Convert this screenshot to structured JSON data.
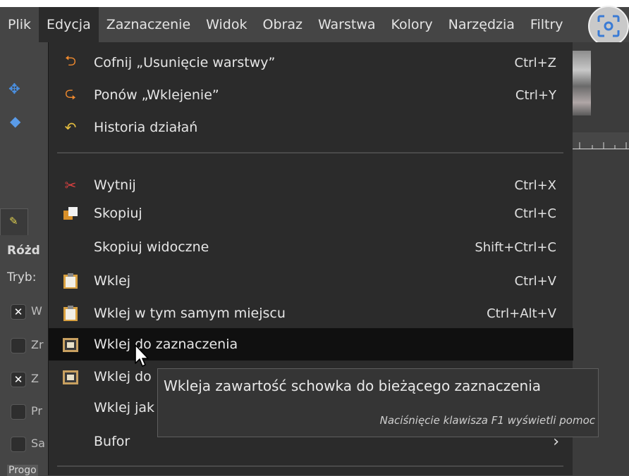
{
  "menubar": {
    "items": [
      "Plik",
      "Edycja",
      "Zaznaczenie",
      "Widok",
      "Obraz",
      "Warstwa",
      "Kolory",
      "Narzędzia",
      "Filtry"
    ],
    "active_index": 1
  },
  "background": {
    "panel_title": "Różd",
    "mode_label": "Tryb:",
    "options": [
      {
        "checked": true,
        "text": "W"
      },
      {
        "checked": false,
        "text": "Zr"
      },
      {
        "checked": true,
        "text": "Z"
      },
      {
        "checked": false,
        "text": "Pr"
      },
      {
        "checked": false,
        "text": "Sa"
      }
    ],
    "bottom_label": "Progo"
  },
  "menu": {
    "items": [
      {
        "label": "Cofnij „Usunięcie warstwy”",
        "shortcut": "Ctrl+Z",
        "icon": "undo-icon"
      },
      {
        "label": "Ponów „Wklejenie”",
        "shortcut": "Ctrl+Y",
        "icon": "redo-icon"
      },
      {
        "label": "Historia działań",
        "shortcut": "",
        "icon": "history-icon"
      },
      {
        "label": "Wytnij",
        "shortcut": "Ctrl+X",
        "icon": "cut-icon"
      },
      {
        "label": "Skopiuj",
        "shortcut": "Ctrl+C",
        "icon": "copy-icon"
      },
      {
        "label": "Skopiuj widoczne",
        "shortcut": "Shift+Ctrl+C",
        "icon": ""
      },
      {
        "label": "Wklej",
        "shortcut": "Ctrl+V",
        "icon": "paste-icon"
      },
      {
        "label": "Wklej w tym samym miejscu",
        "shortcut": "Ctrl+Alt+V",
        "icon": "paste-in-place-icon"
      },
      {
        "label": "Wklej do zaznaczenia",
        "shortcut": "",
        "icon": "paste-into-selection-icon"
      },
      {
        "label": "Wklej do",
        "shortcut": "",
        "icon": "paste-into-selection-in-place-icon"
      },
      {
        "label": "Wklej jak",
        "shortcut": "",
        "icon": ""
      },
      {
        "label": "Bufor",
        "shortcut": "",
        "icon": ""
      }
    ],
    "highlighted_index": 8
  },
  "tooltip": {
    "text": "Wkleja zawartość schowka do bieżącego zaznaczenia",
    "hint": "Naciśnięcie klawisza F1 wyświetli pomoc"
  },
  "colors": {
    "menu_bg": "#2b2b2b",
    "highlight_bg": "#101010",
    "app_bg": "#454545"
  }
}
